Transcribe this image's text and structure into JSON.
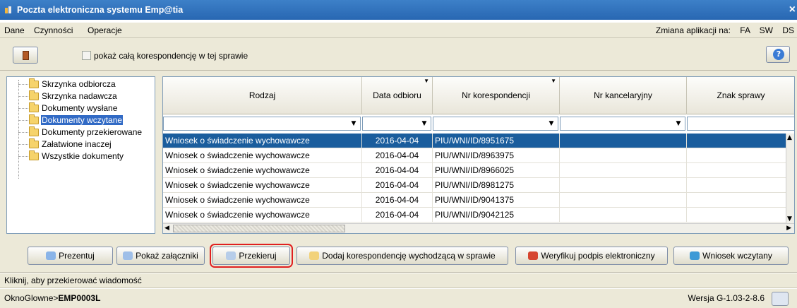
{
  "window": {
    "title": "Poczta elektroniczna systemu Emp@tia",
    "close": "×"
  },
  "menu": {
    "items": [
      "Dane",
      "Czynności",
      "Operacje"
    ],
    "app_switch_label": "Zmiana aplikacji na:",
    "app_switch_options": [
      "FA",
      "SW",
      "DS"
    ]
  },
  "toolbar": {
    "checkbox_label": "pokaż całą korespondencję w tej sprawie",
    "help": "?"
  },
  "tree": {
    "items": [
      {
        "label": "Skrzynka odbiorcza",
        "selected": false
      },
      {
        "label": "Skrzynka nadawcza",
        "selected": false
      },
      {
        "label": "Dokumenty wysłane",
        "selected": false
      },
      {
        "label": "Dokumenty wczytane",
        "selected": true
      },
      {
        "label": "Dokumenty przekierowane",
        "selected": false
      },
      {
        "label": "Załatwione inaczej",
        "selected": false
      },
      {
        "label": "Wszystkie dokumenty",
        "selected": false
      }
    ]
  },
  "grid": {
    "columns": [
      "Rodzaj",
      "Data odbioru",
      "Nr korespondencji",
      "Nr kancelaryjny",
      "Znak sprawy"
    ],
    "rows": [
      {
        "rodzaj": "Wniosek o świadczenie wychowawcze",
        "data": "2016-04-04",
        "nr": "PIU/WNI/ID/8951675",
        "selected": true
      },
      {
        "rodzaj": "Wniosek o świadczenie wychowawcze",
        "data": "2016-04-04",
        "nr": "PIU/WNI/ID/8963975",
        "selected": false
      },
      {
        "rodzaj": "Wniosek o świadczenie wychowawcze",
        "data": "2016-04-04",
        "nr": "PIU/WNI/ID/8966025",
        "selected": false
      },
      {
        "rodzaj": "Wniosek o świadczenie wychowawcze",
        "data": "2016-04-04",
        "nr": "PIU/WNI/ID/8981275",
        "selected": false
      },
      {
        "rodzaj": "Wniosek o świadczenie wychowawcze",
        "data": "2016-04-04",
        "nr": "PIU/WNI/ID/9041375",
        "selected": false
      },
      {
        "rodzaj": "Wniosek o świadczenie wychowawcze",
        "data": "2016-04-04",
        "nr": "PIU/WNI/ID/9042125",
        "selected": false
      }
    ]
  },
  "actions": {
    "prezentuj": "Prezentuj",
    "pokaz_zalaczniki": "Pokaż załączniki",
    "przekieruj": "Przekieruj",
    "dodaj": "Dodaj korespondencję wychodzącą w sprawie",
    "weryfikuj": "Weryfikuj podpis elektroniczny",
    "wniosek": "Wniosek wczytany"
  },
  "status": {
    "hint": "Kliknij, aby przekierować wiadomość",
    "path_prefix": "OknoGlowne>",
    "path_code": "EMP0003L",
    "version": "Wersja G-1.03-2-8.6"
  },
  "colors": {
    "titlebar": "#2867b2",
    "selection": "#1a5d9d",
    "highlight_outline": "#e02020"
  }
}
